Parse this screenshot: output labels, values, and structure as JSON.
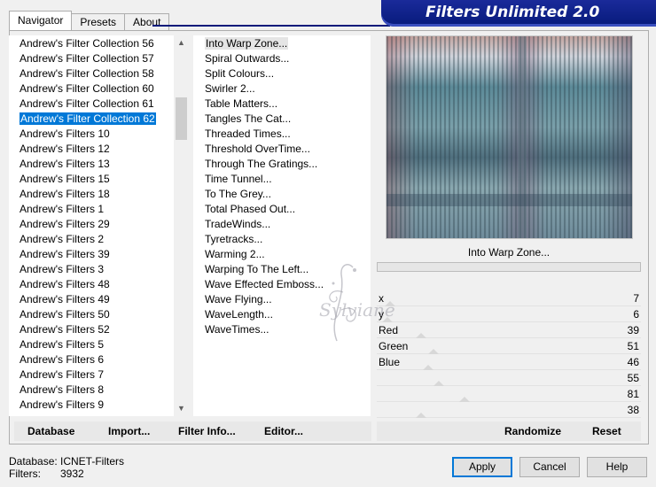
{
  "tabs": [
    {
      "label": "Navigator",
      "active": true
    },
    {
      "label": "Presets",
      "active": false
    },
    {
      "label": "About",
      "active": false
    }
  ],
  "banner_title": "Filters Unlimited 2.0",
  "categories": [
    "Andrew's Filter Collection 56",
    "Andrew's Filter Collection 57",
    "Andrew's Filter Collection 58",
    "Andrew's Filter Collection 60",
    "Andrew's Filter Collection 61",
    "Andrew's Filter Collection 62",
    "Andrew's Filters 10",
    "Andrew's Filters 12",
    "Andrew's Filters 13",
    "Andrew's Filters 15",
    "Andrew's Filters 18",
    "Andrew's Filters 1",
    "Andrew's Filters 29",
    "Andrew's Filters 2",
    "Andrew's Filters 39",
    "Andrew's Filters 3",
    "Andrew's Filters 48",
    "Andrew's Filters 49",
    "Andrew's Filters 50",
    "Andrew's Filters 52",
    "Andrew's Filters 5",
    "Andrew's Filters 6",
    "Andrew's Filters 7",
    "Andrew's Filters 8",
    "Andrew's Filters 9"
  ],
  "selected_category_index": 5,
  "filters": [
    "Into Warp Zone...",
    "Spiral Outwards...",
    "Split Colours...",
    "Swirler 2...",
    "Table Matters...",
    "Tangles The Cat...",
    "Threaded Times...",
    "Threshold OverTime...",
    "Through The Gratings...",
    "Time Tunnel...",
    "To The Grey...",
    "Total Phased Out...",
    "TradeWinds...",
    "Tyretracks...",
    "Warming 2...",
    "Warping To The Left...",
    "Wave Effected Emboss...",
    "Wave Flying...",
    "WaveLength...",
    "WaveTimes..."
  ],
  "selected_filter_index": 0,
  "current_filter_name": "Into Warp Zone...",
  "params": [
    {
      "name": "x",
      "value": "7",
      "level": 0.03
    },
    {
      "name": "y",
      "value": "6",
      "level": 0.02
    },
    {
      "name": "Red",
      "value": "39",
      "level": 0.15
    },
    {
      "name": "Green",
      "value": "51",
      "level": 0.2
    },
    {
      "name": "Blue",
      "value": "46",
      "level": 0.18
    },
    {
      "name": "",
      "value": "55",
      "level": 0.22
    },
    {
      "name": "",
      "value": "81",
      "level": 0.32
    },
    {
      "name": "",
      "value": "38",
      "level": 0.15
    }
  ],
  "left_buttons": {
    "database": "Database",
    "import": "Import...",
    "filter_info": "Filter Info...",
    "editor": "Editor..."
  },
  "right_buttons": {
    "randomize": "Randomize",
    "reset": "Reset"
  },
  "footer": {
    "database_label": "Database:",
    "database_value": "ICNET-Filters",
    "filters_label": "Filters:",
    "filters_value": "3932"
  },
  "dialog_buttons": {
    "apply": "Apply",
    "cancel": "Cancel",
    "help": "Help"
  },
  "watermark_text": "Sylviane",
  "colors": {
    "banner": "#061a7a",
    "selection": "#0078d7"
  }
}
